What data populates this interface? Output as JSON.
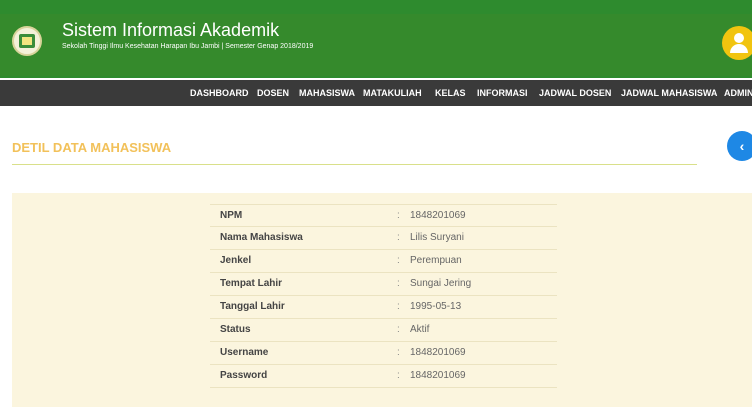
{
  "header": {
    "title": "Sistem Informasi Akademik",
    "subtitle": "Sekolah Tinggi Ilmu Kesehatan Harapan Ibu Jambi | Semester Genap 2018/2019"
  },
  "nav": {
    "items": [
      "DASHBOARD",
      "DOSEN",
      "MAHASISWA",
      "MATAKULIAH",
      "KELAS",
      "INFORMASI",
      "JADWAL DOSEN",
      "JADWAL MAHASISWA",
      "ADMIN"
    ]
  },
  "page": {
    "section_title": "DETIL DATA MAHASISWA",
    "back_icon": "chevron-left-icon"
  },
  "detail": {
    "colon": ":",
    "rows": [
      {
        "label": "NPM",
        "value": "1848201069"
      },
      {
        "label": "Nama Mahasiswa",
        "value": "Lilis Suryani"
      },
      {
        "label": "Jenkel",
        "value": "Perempuan"
      },
      {
        "label": "Tempat Lahir",
        "value": "Sungai Jering"
      },
      {
        "label": "Tanggal Lahir",
        "value": "1995-05-13"
      },
      {
        "label": "Status",
        "value": "Aktif"
      },
      {
        "label": "Username",
        "value": "1848201069"
      },
      {
        "label": "Password",
        "value": "1848201069"
      }
    ]
  },
  "colors": {
    "header_green": "#358a2c",
    "nav_dark": "#3a3a3a",
    "section_title": "#f2c15a",
    "panel_bg": "#fbf5de",
    "back_button": "#1e88e5",
    "avatar": "#f1c40f"
  }
}
